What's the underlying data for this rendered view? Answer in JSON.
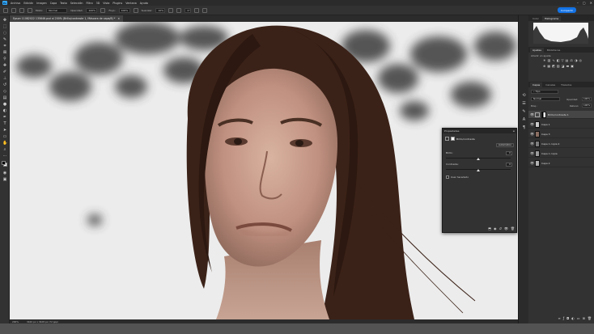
{
  "menubar": {
    "items": [
      "Archivo",
      "Edición",
      "Imagen",
      "Capa",
      "Texto",
      "Selección",
      "Filtro",
      "3D",
      "Vista",
      "Plugins",
      "Ventana",
      "Ayuda"
    ]
  },
  "options": {
    "mode_label": "Modo:",
    "mode_value": "Normal",
    "opacity_label": "Opacidad:",
    "opacity_value": "100%",
    "flow_label": "Flujo:",
    "flow_value": "100%",
    "smooth_label": "Suavizar:",
    "smooth_value": "10%",
    "angle_value": "0°",
    "share_label": "Compartir"
  },
  "document": {
    "tab_title": "Epson 11082022 135646.psd al 200% (Brillo/contraste 1, Máscara de capa/8) *",
    "close": "×"
  },
  "status": {
    "zoom": "200%",
    "info": "3420 px x 3428 px (72 ppp)"
  },
  "histogram": {
    "tab1": "Color",
    "tab2": "Histograma"
  },
  "adjustments": {
    "tab1": "Ajustes",
    "tab2": "Bibliotecas",
    "add_label": "Añadir un ajuste"
  },
  "layers_panel": {
    "tab1": "Capas",
    "tab2": "Canales",
    "tab3": "Trazados",
    "filter_label": "Tipo",
    "blend_mode": "Normal",
    "opacity_label": "Opacidad:",
    "opacity_value": "100%",
    "lock_label": "Bloq.:",
    "fill_label": "Relleno:",
    "fill_value": "100%",
    "layers": [
      {
        "name": "Brillo/contraste 1",
        "selected": true
      },
      {
        "name": "Capa 1",
        "selected": false
      },
      {
        "name": "Capa 3",
        "selected": false
      },
      {
        "name": "Capa 1 copia 2",
        "selected": false
      },
      {
        "name": "Capa 1 copia",
        "selected": false
      },
      {
        "name": "Capa 2",
        "selected": false
      }
    ]
  },
  "properties": {
    "title": "Propiedades",
    "subtitle": "Brillo/contraste",
    "auto_label": "Automático",
    "brightness_label": "Brillo:",
    "brightness_value": "0",
    "contrast_label": "Contraste:",
    "contrast_value": "0",
    "legacy_label": "Usar heredado",
    "brightness_level": 0.5,
    "contrast_level": 0.5
  },
  "colors": {
    "accent": "#1473e6",
    "panel": "#323232",
    "dark": "#262626"
  }
}
